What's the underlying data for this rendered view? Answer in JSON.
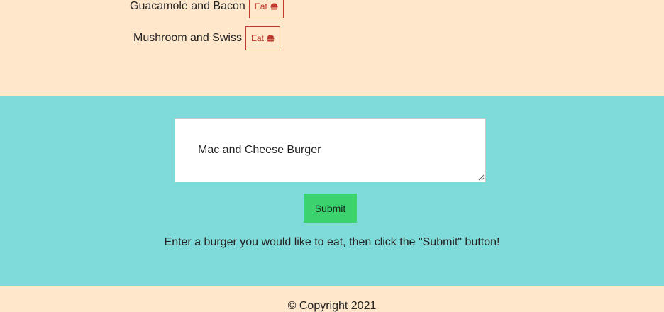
{
  "burger_list": [
    {
      "name": "Guacamole and Bacon",
      "button_label": "Eat",
      "button_icon": "burger-icon"
    },
    {
      "name": "Mushroom and Swiss",
      "button_label": "Eat",
      "button_icon": "burger-icon"
    }
  ],
  "form": {
    "textarea_value": "Mac and Cheese Burger",
    "submit_label": "Submit",
    "instructions": "Enter a burger you would like to eat, then click the \"Submit\" button!"
  },
  "footer": {
    "copyright": "© Copyright 2021"
  },
  "colors": {
    "page_background": "#ffe7cc",
    "form_background": "#7fdbda",
    "submit_button": "#3ad36e",
    "eat_button_accent": "#c0392b"
  }
}
